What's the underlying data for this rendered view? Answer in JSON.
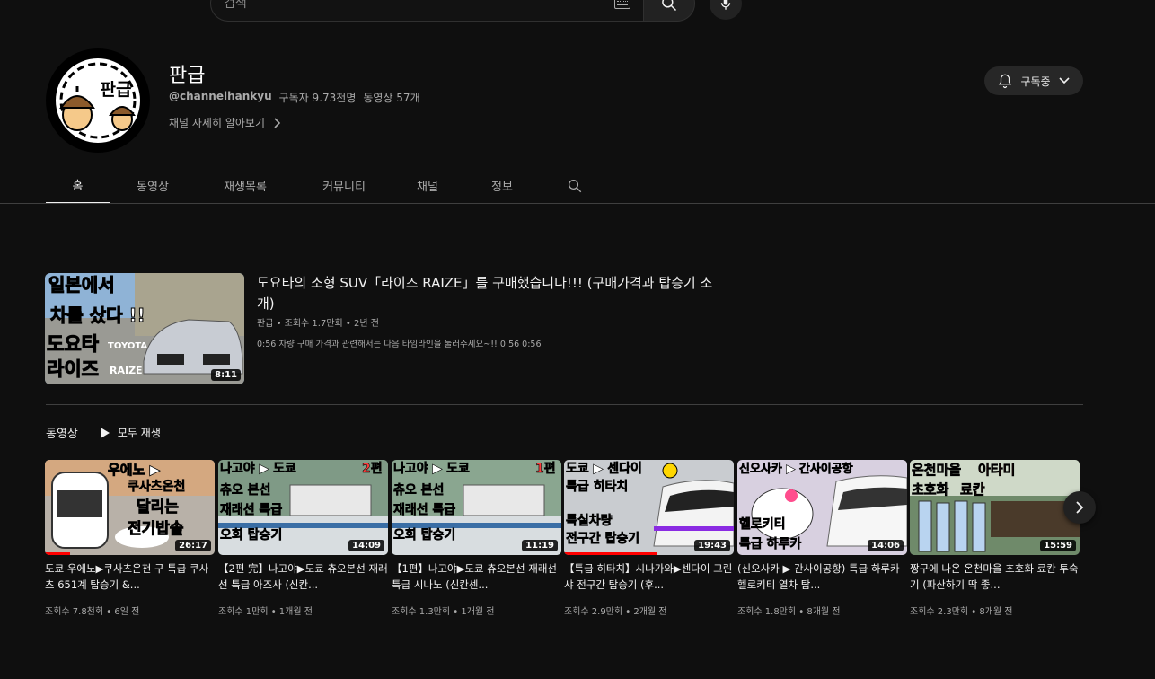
{
  "search": {
    "placeholder": "검색"
  },
  "channel": {
    "name": "판급",
    "avatar_text": "판급",
    "handle": "@channelhankyu",
    "subscribers": "구독자 9.73천명",
    "video_count": "동영상 57개",
    "more_link": "채널 자세히 알아보기",
    "subscribe_label": "구독중"
  },
  "tabs": [
    {
      "label": "홈"
    },
    {
      "label": "동영상"
    },
    {
      "label": "재생목록"
    },
    {
      "label": "커뮤니티"
    },
    {
      "label": "채널"
    },
    {
      "label": "정보"
    }
  ],
  "featured": {
    "title": "도요타의 소형 SUV「라이즈 RAIZE」를 구매했습니다!!! (구매가격과 탑승기 소개)",
    "meta": "판급 • 조회수 1.7만회 • 2년 전",
    "description": "0:56 차량 구매 가격과 관련해서는 다음 타임라인을 눌러주세요~!! 0:56 0:56",
    "duration": "8:11",
    "thumb_text": [
      "일본에서",
      "차를 샀다 !!",
      "도요타",
      "라이즈",
      "TOYOTA",
      "RAIZE"
    ]
  },
  "shelf": {
    "title": "동영상",
    "play_all": "모두 재생",
    "videos": [
      {
        "title": "도쿄 우에노▶쿠사츠온천 구 특급 쿠사츠 651계 탑승기 &...",
        "meta": "조회수 7.8천회 • 6일 전",
        "duration": "26:17",
        "progress": 0.15,
        "thumb": [
          "우에노 ▶",
          "쿠사츠온천",
          "달리는",
          "전기밥솥"
        ],
        "bg": "#b8b1a8"
      },
      {
        "title": "【2편 完】나고야▶도쿄 츄오본선 재래선 특급 아즈사 (신칸...",
        "meta": "조회수 1만회 • 1개월 전",
        "duration": "14:09",
        "progress": 0,
        "thumb": [
          "나고야 ▶ 도쿄",
          "2편",
          "츄오 본선",
          "재래선 특급",
          "오회 탑승기"
        ],
        "bg": "#7f9a86"
      },
      {
        "title": "【1편】나고야▶도쿄 츄오본선 재래선 특급 시나노 (신칸센...",
        "meta": "조회수 1.3만회 • 1개월 전",
        "duration": "11:19",
        "progress": 0,
        "thumb": [
          "나고야 ▶ 도쿄",
          "1편",
          "츄오 본선",
          "재래선 특급",
          "오회 탑승기"
        ],
        "bg": "#8aa690"
      },
      {
        "title": "【특급 히타치】시나가와▶센다이 그린샤 전구간 탑승기 (후...",
        "meta": "조회수 2.9만회 • 2개월 전",
        "duration": "19:43",
        "progress": 0.55,
        "thumb": [
          "도쿄 ▶ 센다이",
          "특급 히타치",
          "특실차량",
          "전구간 탑승기"
        ],
        "bg": "#c9ccd0"
      },
      {
        "title": "(신오사카 ▶ 간사이공항) 특급 하루카 헬로키티 열차 탑...",
        "meta": "조회수 1.8만회 • 8개월 전",
        "duration": "14:06",
        "progress": 0,
        "thumb": [
          "신오사카 ▶ 간사이공항",
          "헬로키티",
          "특급 하루카"
        ],
        "bg": "#d8d0e0"
      },
      {
        "title": "짱구에 나온 온천마을 초호화 료칸 투숙기 (파산하기 딱 좋...",
        "meta": "조회수 2.3만회 • 8개월 전",
        "duration": "15:59",
        "progress": 0,
        "thumb": [
          "온천마을",
          "아타미",
          "초호화",
          "료칸"
        ],
        "bg": "#6f8a6a"
      }
    ]
  },
  "colors": {
    "background": "#0f0f0f",
    "text": "#f1f1f1",
    "secondary": "#aaaaaa",
    "accent_red": "#ff0000"
  }
}
